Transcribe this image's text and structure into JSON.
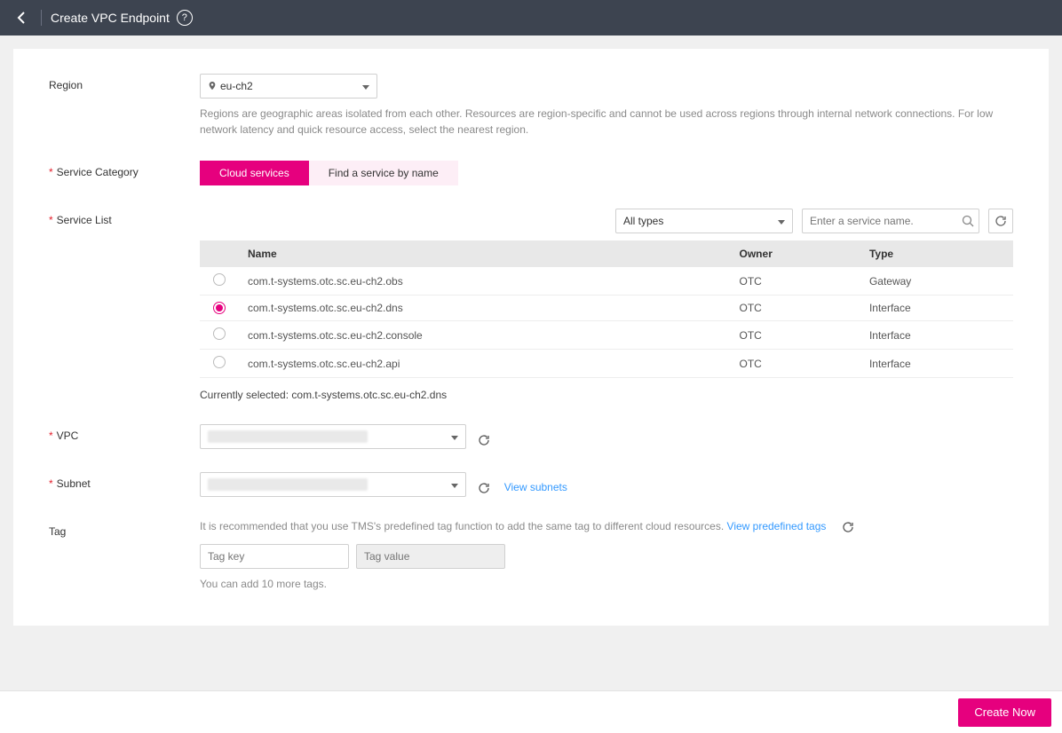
{
  "header": {
    "title": "Create VPC Endpoint"
  },
  "region": {
    "label": "Region",
    "value": "eu-ch2",
    "helper": "Regions are geographic areas isolated from each other. Resources are region-specific and cannot be used across regions through internal network connections. For low network latency and quick resource access, select the nearest region."
  },
  "service_category": {
    "label": "Service Category",
    "options": [
      "Cloud services",
      "Find a service by name"
    ],
    "selected": "Cloud services"
  },
  "service_list": {
    "label": "Service List",
    "type_filter": "All types",
    "search_placeholder": "Enter a service name.",
    "columns": [
      "Name",
      "Owner",
      "Type"
    ],
    "rows": [
      {
        "name": "com.t-systems.otc.sc.eu-ch2.obs",
        "owner": "OTC",
        "type": "Gateway",
        "selected": false
      },
      {
        "name": "com.t-systems.otc.sc.eu-ch2.dns",
        "owner": "OTC",
        "type": "Interface",
        "selected": true
      },
      {
        "name": "com.t-systems.otc.sc.eu-ch2.console",
        "owner": "OTC",
        "type": "Interface",
        "selected": false
      },
      {
        "name": "com.t-systems.otc.sc.eu-ch2.api",
        "owner": "OTC",
        "type": "Interface",
        "selected": false
      }
    ],
    "currently_selected_prefix": "Currently selected: ",
    "currently_selected_value": "com.t-systems.otc.sc.eu-ch2.dns"
  },
  "vpc": {
    "label": "VPC"
  },
  "subnet": {
    "label": "Subnet",
    "view_link": "View subnets"
  },
  "tag": {
    "label": "Tag",
    "helper_prefix": "It is recommended that you use TMS's predefined tag function to add the same tag to different cloud resources. ",
    "view_link": "View predefined tags",
    "key_placeholder": "Tag key",
    "value_placeholder": "Tag value",
    "remaining": "You can add 10 more tags."
  },
  "footer": {
    "create": "Create Now"
  }
}
